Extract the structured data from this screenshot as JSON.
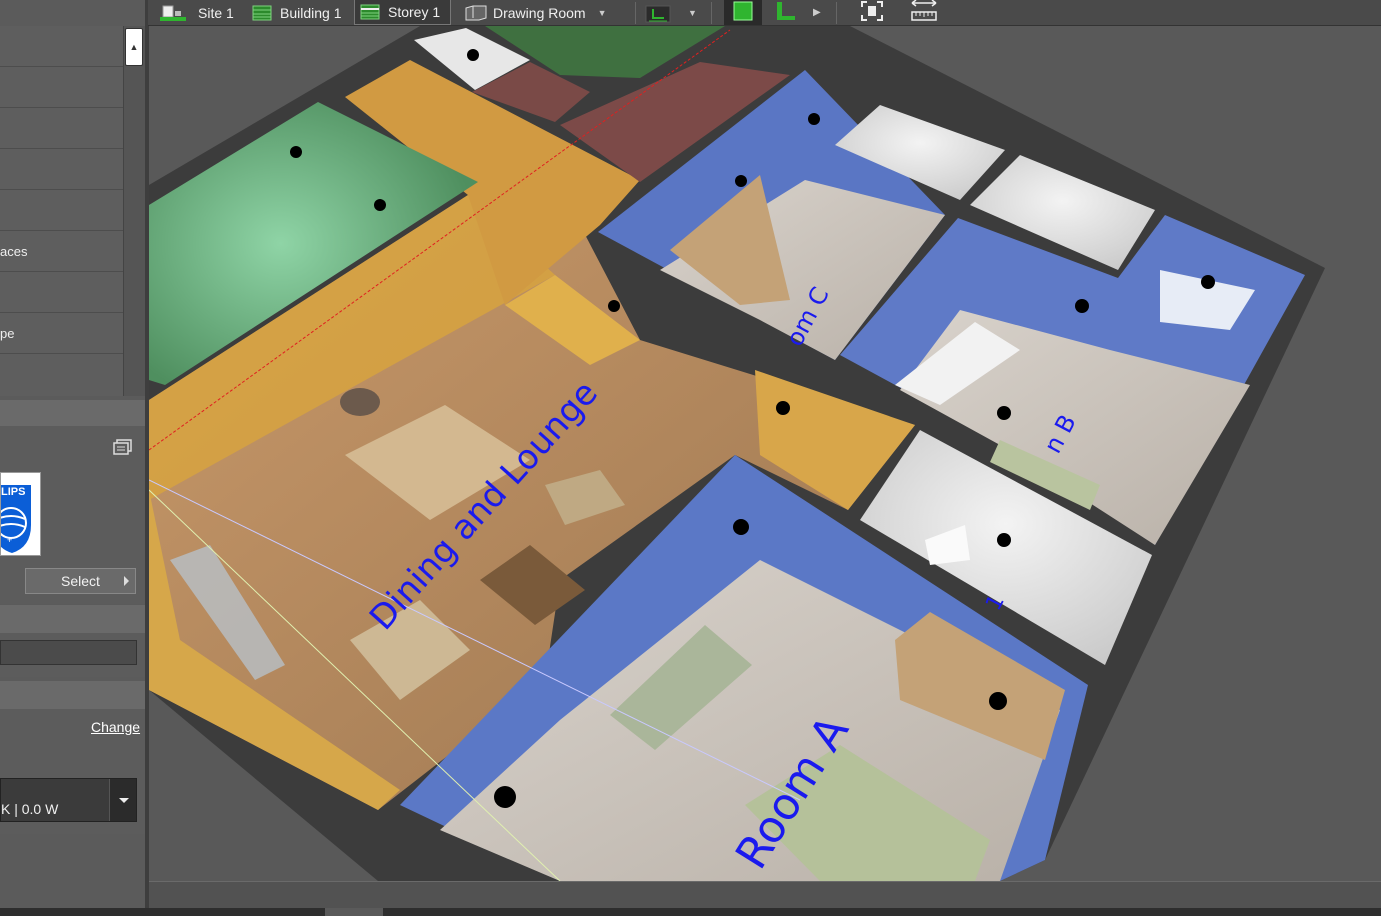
{
  "toolbar": {
    "site": "Site 1",
    "building": "Building 1",
    "storey": "Storey 1",
    "room": "Drawing Room"
  },
  "left_panel": {
    "list_items": [
      "",
      "",
      "",
      "",
      "aces",
      "",
      "pe",
      ""
    ],
    "logo_text": "LIPS",
    "select_label": "Select",
    "change_label": "Change",
    "dropdown_value": "K  |  0.0 W"
  },
  "rooms": {
    "dining": "Dining and Lounge",
    "room_a": "Room A",
    "room_b": "n B",
    "room_c": "om C",
    "bath": "1"
  },
  "colors": {
    "accent_green": "#2fb52f",
    "label_blue": "#1a1aee",
    "wall_blue": "#5a76c4",
    "floor_wood": "#b58a5e"
  }
}
